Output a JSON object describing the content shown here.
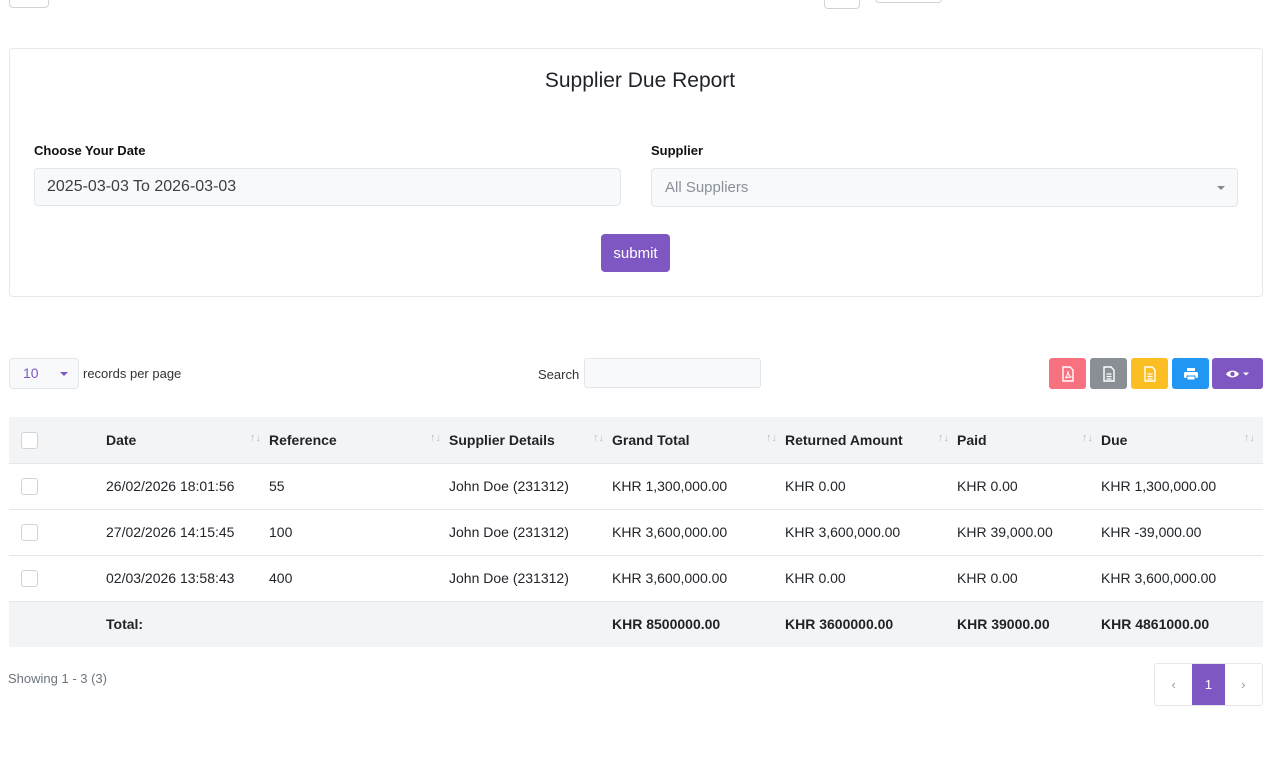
{
  "report": {
    "title": "Supplier Due Report",
    "date_label": "Choose Your Date",
    "date_value": "2025-03-03 To 2026-03-03",
    "supplier_label": "Supplier",
    "supplier_value": "All Suppliers",
    "submit_label": "submit"
  },
  "table_controls": {
    "page_length": "10",
    "page_length_suffix": "records per page",
    "search_label": "Search",
    "search_value": "",
    "export_buttons": [
      {
        "name": "pdf",
        "icon": "pdf-icon",
        "color": "#f8717f"
      },
      {
        "name": "csv",
        "icon": "document-icon",
        "color": "#8a8f96"
      },
      {
        "name": "excel",
        "icon": "excel-icon",
        "color": "#fbbf24"
      },
      {
        "name": "print",
        "icon": "print-icon",
        "color": "#2196f3"
      },
      {
        "name": "columns",
        "icon": "eye-icon",
        "color": "#7e57c2"
      }
    ]
  },
  "table": {
    "headers": [
      "Date",
      "Reference",
      "Supplier Details",
      "Grand Total",
      "Returned Amount",
      "Paid",
      "Due"
    ],
    "rows": [
      {
        "date": "26/02/2026 18:01:56",
        "reference": "55",
        "supplier": "John Doe (231312)",
        "grand_total": "KHR 1,300,000.00",
        "returned": "KHR 0.00",
        "paid": "KHR 0.00",
        "due": "KHR 1,300,000.00"
      },
      {
        "date": "27/02/2026 14:15:45",
        "reference": "100",
        "supplier": "John Doe (231312)",
        "grand_total": "KHR 3,600,000.00",
        "returned": "KHR 3,600,000.00",
        "paid": "KHR 39,000.00",
        "due": "KHR -39,000.00"
      },
      {
        "date": "02/03/2026 13:58:43",
        "reference": "400",
        "supplier": "John Doe (231312)",
        "grand_total": "KHR 3,600,000.00",
        "returned": "KHR 0.00",
        "paid": "KHR 0.00",
        "due": "KHR 3,600,000.00"
      }
    ],
    "footer": {
      "label": "Total:",
      "grand_total": "KHR 8500000.00",
      "returned": "KHR 3600000.00",
      "paid": "KHR 39000.00",
      "due": "KHR 4861000.00"
    }
  },
  "pagination": {
    "showing": "Showing 1 - 3 (3)",
    "prev": "‹",
    "current": "1",
    "next": "›"
  },
  "colors": {
    "accent": "#7e57c2"
  }
}
